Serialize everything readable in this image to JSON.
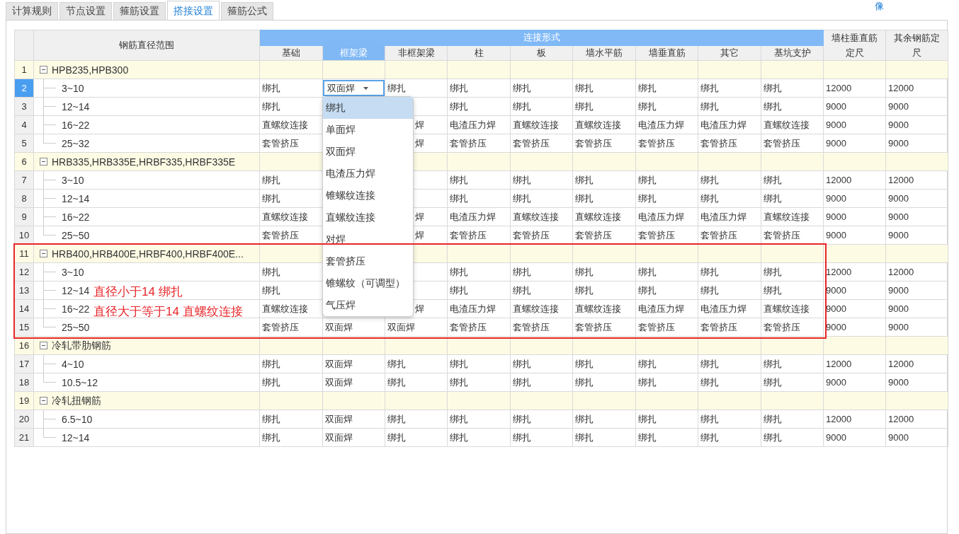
{
  "tabs": [
    {
      "label": "计算规则",
      "selected": false
    },
    {
      "label": "节点设置",
      "selected": false
    },
    {
      "label": "箍筋设置",
      "selected": false
    },
    {
      "label": "搭接设置",
      "selected": true
    },
    {
      "label": "箍筋公式",
      "selected": false
    }
  ],
  "corner_text": "像",
  "table": {
    "tree_header": "钢筋直径范围",
    "group_header": "连接形式",
    "columns": [
      {
        "label": "基础",
        "selected": false
      },
      {
        "label": "框架梁",
        "selected": true
      },
      {
        "label": "非框架梁",
        "selected": false
      },
      {
        "label": "柱",
        "selected": false
      },
      {
        "label": "板",
        "selected": false
      },
      {
        "label": "墙水平筋",
        "selected": false
      },
      {
        "label": "墙垂直筋",
        "selected": false
      },
      {
        "label": "其它",
        "selected": false
      },
      {
        "label": "基坑支护",
        "selected": false
      }
    ],
    "extra_columns": [
      "墙柱垂直筋定尺",
      "其余钢筋定尺"
    ],
    "groups": [
      {
        "number": "1",
        "label": "HPB235,HPB300",
        "expanded": true,
        "highlighted": false,
        "children": [
          {
            "number": "2",
            "label": "3~10",
            "selected": true,
            "cells": [
              "绑扎",
              "双面焊",
              "绑扎",
              "绑扎",
              "绑扎",
              "绑扎",
              "绑扎",
              "绑扎",
              "绑扎",
              "12000",
              "12000"
            ]
          },
          {
            "number": "3",
            "label": "12~14",
            "selected": false,
            "cells": [
              "绑扎",
              null,
              null,
              "绑扎",
              "绑扎",
              "绑扎",
              "绑扎",
              "绑扎",
              "绑扎",
              "9000",
              "9000"
            ]
          },
          {
            "number": "4",
            "label": "16~22",
            "selected": false,
            "cells": [
              "直螺纹连接",
              null,
              "焊",
              "电渣压力焊",
              "直螺纹连接",
              "直螺纹连接",
              "电渣压力焊",
              "电渣压力焊",
              "直螺纹连接",
              "9000",
              "9000"
            ]
          },
          {
            "number": "5",
            "label": "25~32",
            "selected": false,
            "cells": [
              "套管挤压",
              null,
              "焊",
              "套管挤压",
              "套管挤压",
              "套管挤压",
              "套管挤压",
              "套管挤压",
              "套管挤压",
              "9000",
              "9000"
            ]
          }
        ]
      },
      {
        "number": "6",
        "label": "HRB335,HRB335E,HRBF335,HRBF335E",
        "expanded": true,
        "highlighted": false,
        "children": [
          {
            "number": "7",
            "label": "3~10",
            "selected": false,
            "cells": [
              "绑扎",
              null,
              null,
              "绑扎",
              "绑扎",
              "绑扎",
              "绑扎",
              "绑扎",
              "绑扎",
              "12000",
              "12000"
            ]
          },
          {
            "number": "8",
            "label": "12~14",
            "selected": false,
            "cells": [
              "绑扎",
              null,
              null,
              "绑扎",
              "绑扎",
              "绑扎",
              "绑扎",
              "绑扎",
              "绑扎",
              "9000",
              "9000"
            ]
          },
          {
            "number": "9",
            "label": "16~22",
            "selected": false,
            "cells": [
              "直螺纹连接",
              null,
              "焊",
              "电渣压力焊",
              "直螺纹连接",
              "直螺纹连接",
              "电渣压力焊",
              "电渣压力焊",
              "直螺纹连接",
              "9000",
              "9000"
            ]
          },
          {
            "number": "10",
            "label": "25~50",
            "selected": false,
            "cells": [
              "套管挤压",
              null,
              "焊",
              "套管挤压",
              "套管挤压",
              "套管挤压",
              "套管挤压",
              "套管挤压",
              "套管挤压",
              "9000",
              "9000"
            ]
          }
        ]
      },
      {
        "number": "11",
        "label": "HRB400,HRB400E,HRBF400,HRBF400E...",
        "expanded": true,
        "highlighted": true,
        "children": [
          {
            "number": "12",
            "label": "3~10",
            "selected": false,
            "cells": [
              "绑扎",
              null,
              null,
              "绑扎",
              "绑扎",
              "绑扎",
              "绑扎",
              "绑扎",
              "绑扎",
              "12000",
              "12000"
            ]
          },
          {
            "number": "13",
            "label": "12~14",
            "selected": false,
            "cells": [
              "绑扎",
              null,
              null,
              "绑扎",
              "绑扎",
              "绑扎",
              "绑扎",
              "绑扎",
              "绑扎",
              "9000",
              "9000"
            ]
          },
          {
            "number": "14",
            "label": "16~22",
            "selected": false,
            "cells": [
              "直螺纹连接",
              null,
              "焊",
              "电渣压力焊",
              "直螺纹连接",
              "直螺纹连接",
              "电渣压力焊",
              "电渣压力焊",
              "直螺纹连接",
              "9000",
              "9000"
            ]
          },
          {
            "number": "15",
            "label": "25~50",
            "selected": false,
            "cells": [
              "套管挤压",
              "双面焊",
              "双面焊",
              "套管挤压",
              "套管挤压",
              "套管挤压",
              "套管挤压",
              "套管挤压",
              "套管挤压",
              "9000",
              "9000"
            ]
          }
        ]
      },
      {
        "number": "16",
        "label": "冷轧带肋钢筋",
        "expanded": true,
        "highlighted": false,
        "children": [
          {
            "number": "17",
            "label": "4~10",
            "selected": false,
            "cells": [
              "绑扎",
              "双面焊",
              "绑扎",
              "绑扎",
              "绑扎",
              "绑扎",
              "绑扎",
              "绑扎",
              "绑扎",
              "12000",
              "12000"
            ]
          },
          {
            "number": "18",
            "label": "10.5~12",
            "selected": false,
            "cells": [
              "绑扎",
              "双面焊",
              "绑扎",
              "绑扎",
              "绑扎",
              "绑扎",
              "绑扎",
              "绑扎",
              "绑扎",
              "9000",
              "9000"
            ]
          }
        ]
      },
      {
        "number": "19",
        "label": "冷轧扭钢筋",
        "expanded": true,
        "highlighted": false,
        "children": [
          {
            "number": "20",
            "label": "6.5~10",
            "selected": false,
            "cells": [
              "绑扎",
              "双面焊",
              "绑扎",
              "绑扎",
              "绑扎",
              "绑扎",
              "绑扎",
              "绑扎",
              "绑扎",
              "12000",
              "12000"
            ]
          },
          {
            "number": "21",
            "label": "12~14",
            "selected": false,
            "cells": [
              "绑扎",
              "双面焊",
              "绑扎",
              "绑扎",
              "绑扎",
              "绑扎",
              "绑扎",
              "绑扎",
              "绑扎",
              "9000",
              "9000"
            ]
          }
        ]
      }
    ],
    "dropdown": {
      "open": true,
      "options": [
        {
          "label": "绑扎",
          "selected": true
        },
        {
          "label": "单面焊",
          "selected": false
        },
        {
          "label": "双面焊",
          "selected": false
        },
        {
          "label": "电渣压力焊",
          "selected": false
        },
        {
          "label": "锥螺纹连接",
          "selected": false
        },
        {
          "label": "直螺纹连接",
          "selected": false
        },
        {
          "label": "对焊",
          "selected": false
        },
        {
          "label": "套管挤压",
          "selected": false
        },
        {
          "label": "锥螺纹（可调型）",
          "selected": false
        },
        {
          "label": "气压焊",
          "selected": false
        }
      ]
    },
    "annotation": {
      "lines": [
        "直径小于14 绑扎",
        "直径大于等于14 直螺纹连接"
      ]
    }
  }
}
